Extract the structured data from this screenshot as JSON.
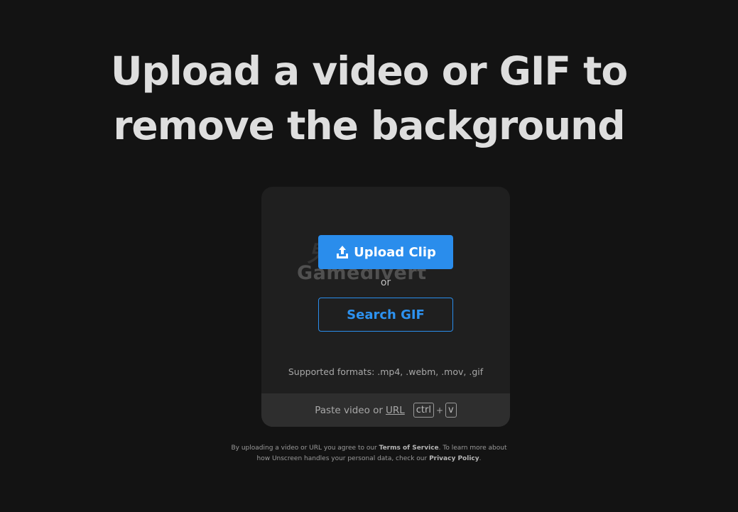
{
  "headline": {
    "line1": "Upload a video or GIF to",
    "line2": "remove the background"
  },
  "card": {
    "upload_label": "Upload Clip",
    "upload_icon": "upload-icon",
    "or_text": "or",
    "search_label": "Search GIF",
    "formats_text": "Supported formats: .mp4, .webm, .mov, .gif",
    "paste_prefix": "Paste video or",
    "paste_link": "URL",
    "key1": "ctrl",
    "key_plus": "+",
    "key2": "v"
  },
  "watermark": {
    "top": "鬼谷魅影",
    "bottom": "Gamedivert"
  },
  "legal": {
    "part1": "By uploading a video or URL you agree to our",
    "terms": "Terms of Service",
    "part2": ". To learn more about",
    "part3": "how Unscreen handles your personal data, check our",
    "privacy": "Privacy Policy",
    "part4": "."
  },
  "colors": {
    "background": "#131313",
    "card": "#1f1f1f",
    "paste_bar": "#2e2e2e",
    "accent": "#2a8dec"
  }
}
